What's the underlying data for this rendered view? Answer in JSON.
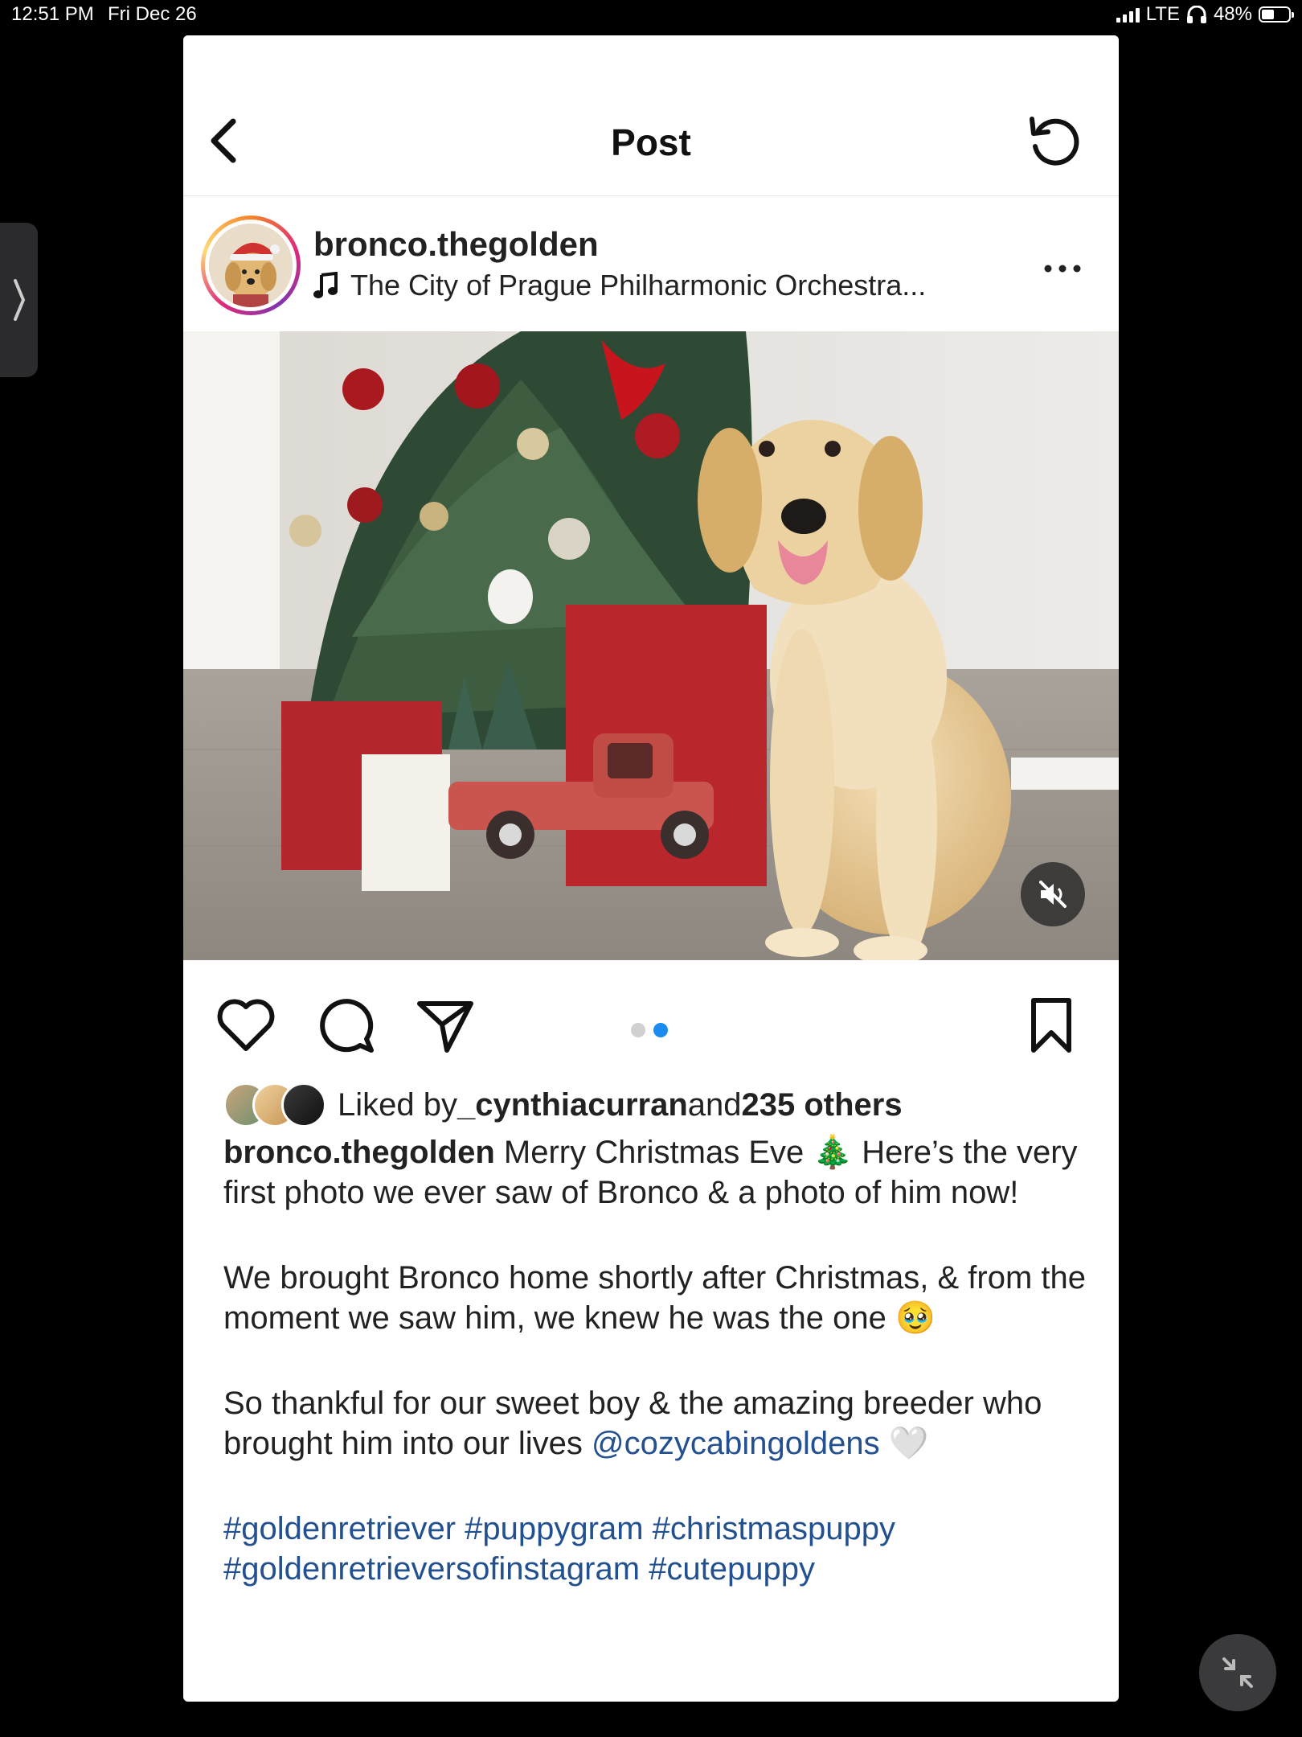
{
  "status_bar": {
    "time": "12:51 PM",
    "date": "Fri Dec 26",
    "network": "LTE",
    "battery": "48%",
    "battery_level": 0.48
  },
  "header": {
    "title": "Post",
    "back_icon": "chevron-left-icon",
    "refresh_icon": "refresh-icon"
  },
  "post": {
    "username": "bronco.thegolden",
    "audio": "The City of Prague Philharmonic Orchestra...",
    "carousel": {
      "count": 2,
      "active": 2
    },
    "likes": {
      "prefix": "Liked by ",
      "user": "_cynthiacurran",
      "middle": " and ",
      "count": "235 others"
    },
    "caption": {
      "username": "bronco.thegolden",
      "line1": " Merry Christmas Eve 🎄 Here’s the very first photo we ever saw of Bronco & a photo of him now!",
      "para2": "We brought Bronco home shortly after Christmas, & from the moment we saw him, we knew he was the one 🥹",
      "para3_text": "So thankful for our sweet boy & the amazing breeder who brought him into our lives ",
      "para3_mention": "@cozycabingoldens",
      "para3_emoji": " 🤍",
      "hashtags": "#goldenretriever #puppygram #christmaspuppy #goldenretrieversofinstagram #cutepuppy"
    }
  },
  "colors": {
    "link": "#23508e",
    "carousel_active": "#1a8cf0"
  }
}
